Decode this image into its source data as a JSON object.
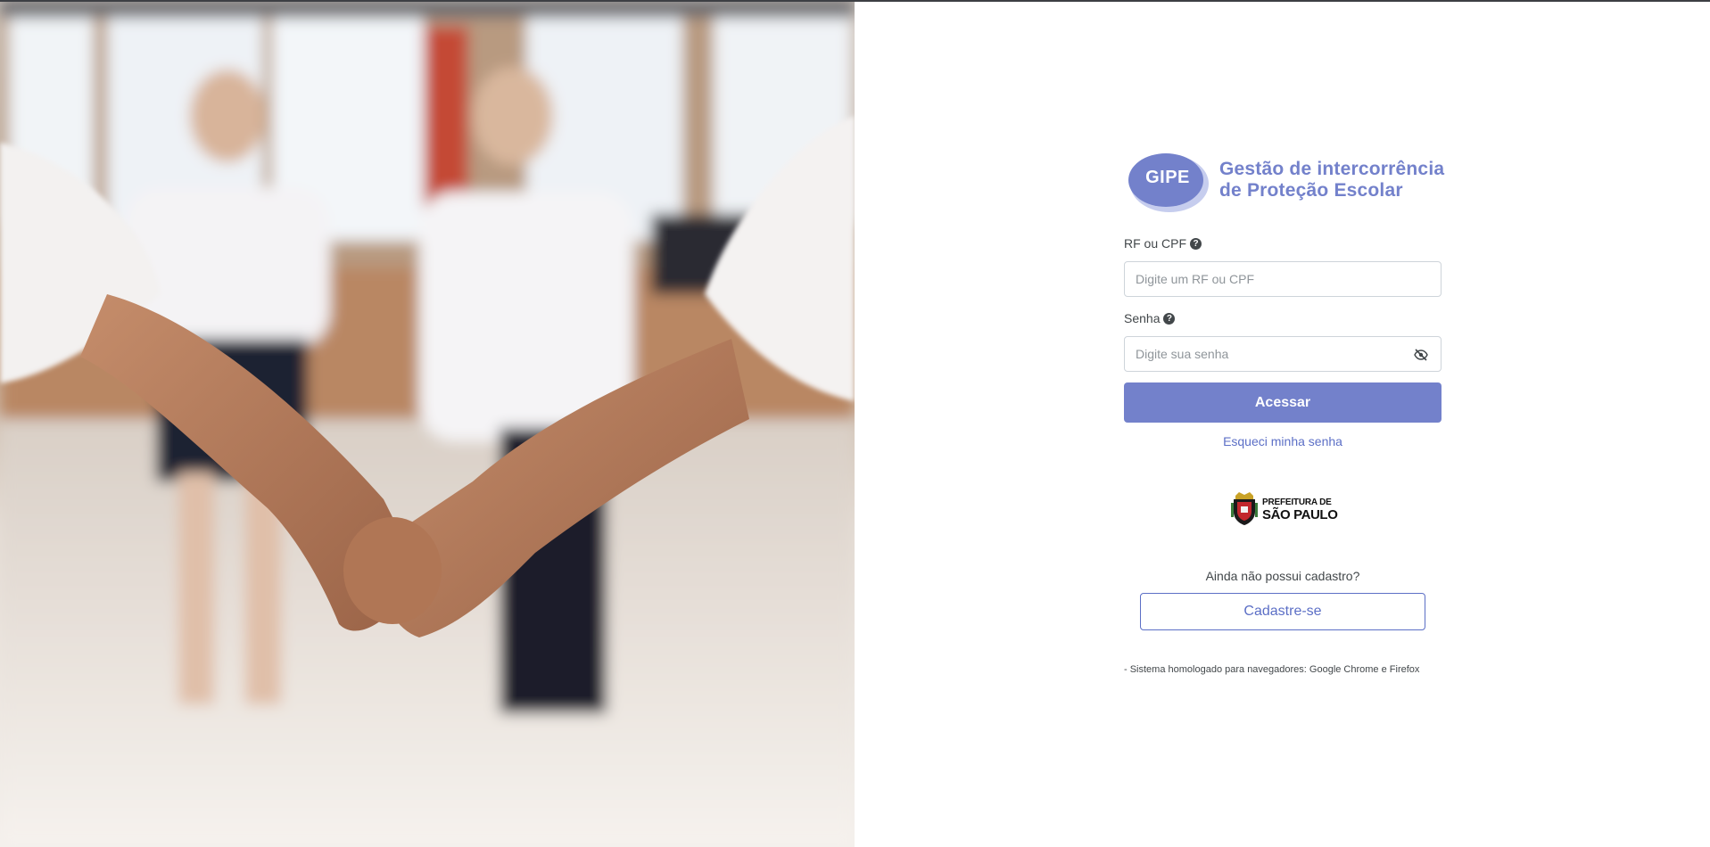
{
  "hero": {
    "image_description_icon": "children-holding-hands-photo"
  },
  "brand": {
    "abbreviation": "GIPE",
    "title_line1": "Gestão de intercorrência",
    "title_line2": "de Proteção Escolar",
    "color": "#7381cb"
  },
  "form": {
    "username_label": "RF ou CPF",
    "username_help": "?",
    "username_placeholder": "Digite um RF ou CPF",
    "username_value": "",
    "password_label": "Senha",
    "password_help": "?",
    "password_placeholder": "Digite sua senha",
    "password_value": "",
    "password_toggle_icon": "eye-slash-icon",
    "submit_label": "Acessar",
    "forgot_label": "Esqueci minha senha"
  },
  "city_logo": {
    "line1": "PREFEITURA DE",
    "line2": "SÃO PAULO"
  },
  "signup": {
    "prompt": "Ainda não possui cadastro?",
    "button_label": "Cadastre-se"
  },
  "footnote": "- Sistema homologado para navegadores: Google Chrome e Firefox",
  "colors": {
    "primary": "#7381cb",
    "link": "#5c6fc6",
    "text": "#42474a",
    "border": "#ced4da"
  }
}
